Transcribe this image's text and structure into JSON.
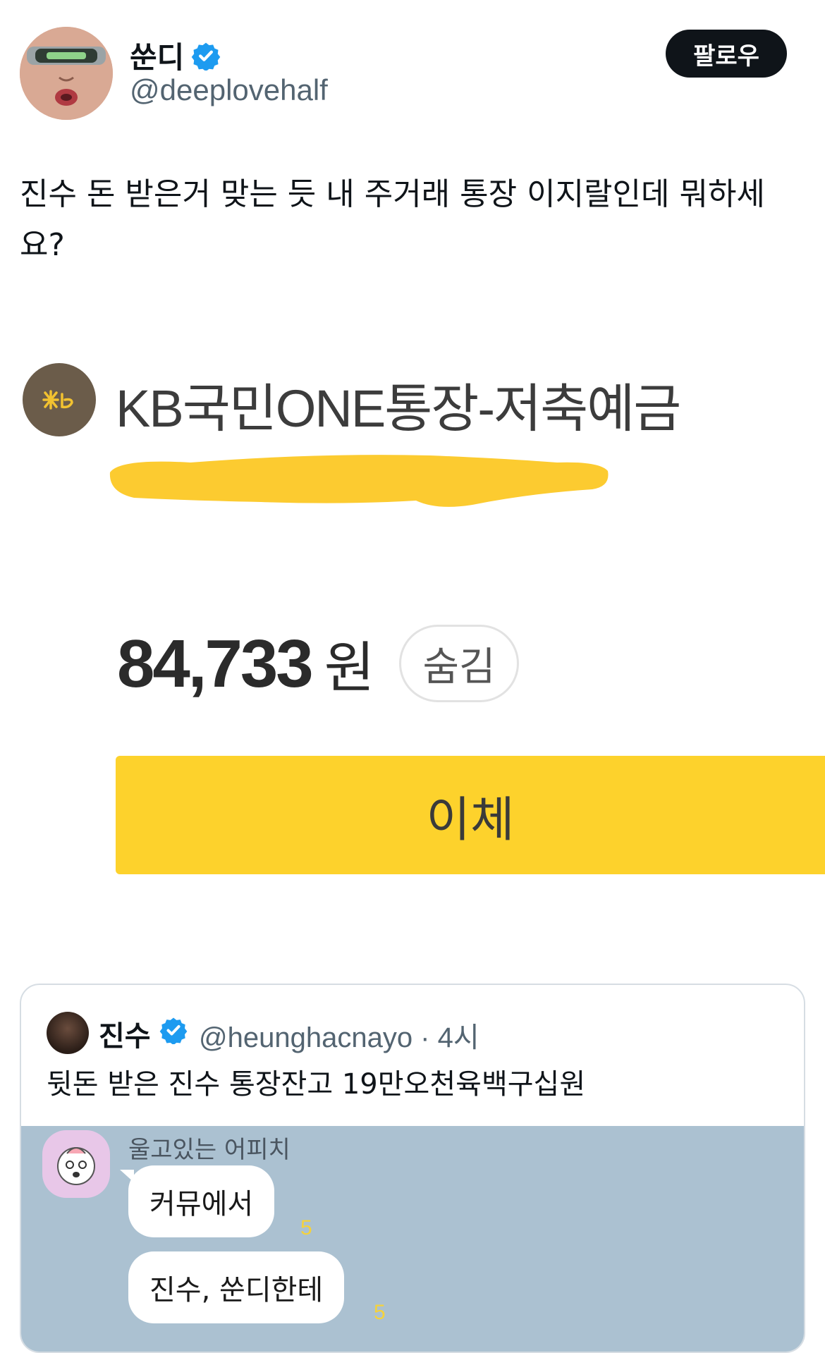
{
  "tweet": {
    "display_name": "쑨디",
    "handle": "@deeplovehalf",
    "follow_label": "팔로우",
    "text": "진수 돈 받은거 맞는 듯 내 주거래 통장 이지랄인데 뭐하세요?"
  },
  "bank": {
    "account_name": "KB국민ONE통장-저축예금",
    "balance": "84,733",
    "unit": "원",
    "hide_label": "숨김",
    "transfer_label": "이체",
    "colors": {
      "accent": "#fdd22c",
      "logo_bg": "#6b5c4a"
    }
  },
  "quote": {
    "display_name": "진수",
    "meta": "@heunghacnayo · 4시",
    "text": "뒷돈 받은 진수 통장잔고 19만오천육백구십원",
    "chat": {
      "sender": "울고있는 어피치",
      "messages": [
        {
          "text": "커뮤에서",
          "unread": "5"
        },
        {
          "text": "진수, 쑨디한테",
          "unread": "5"
        }
      ]
    }
  },
  "icons": [
    "verified-badge-icon",
    "kb-logo-icon",
    "apeach-avatar-icon"
  ]
}
